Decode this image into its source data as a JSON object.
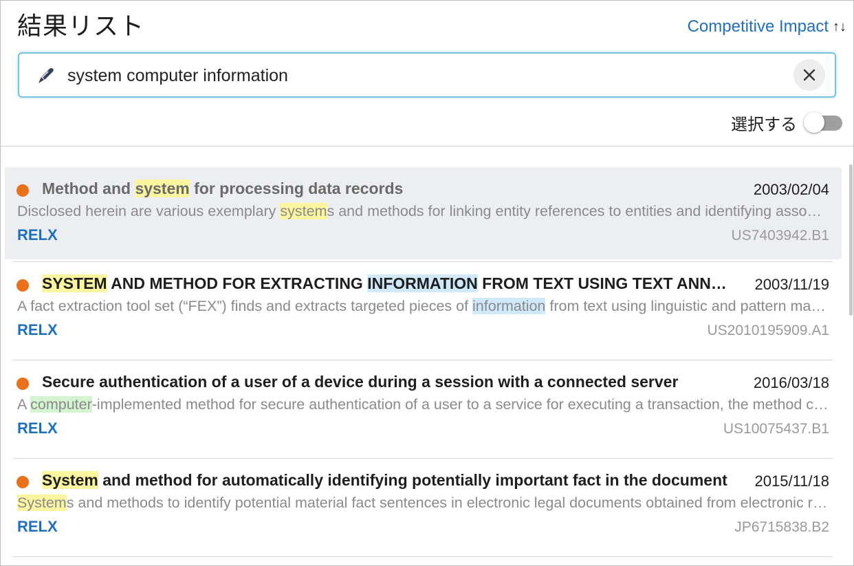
{
  "header": {
    "title": "結果リスト",
    "sort_label": "Competitive Impact",
    "sort_icon": "↑↓"
  },
  "search": {
    "value": "system computer information",
    "clear_icon": "×"
  },
  "select_toggle": {
    "label": "選択する",
    "on": false
  },
  "colors": {
    "accent": "#1f6fc0",
    "dot": "#e9711c",
    "highlight_system": "#fbf5a0",
    "highlight_information": "#cfe8fa",
    "highlight_computer": "#d4f3d0"
  },
  "results": [
    {
      "selected": true,
      "title": [
        {
          "t": "Method and "
        },
        {
          "t": "system",
          "hl": "y"
        },
        {
          "t": " for processing data records"
        }
      ],
      "date": "2003/02/04",
      "snippet": [
        {
          "t": "Disclosed herein are various exemplary "
        },
        {
          "t": "system",
          "hl": "y"
        },
        {
          "t": "s and methods for linking entity references to entities and identifying associations among entity references"
        }
      ],
      "source": "RELX",
      "pubno": "US7403942.B1"
    },
    {
      "selected": false,
      "title": [
        {
          "t": "SYSTEM",
          "hl": "y"
        },
        {
          "t": " AND METHOD FOR EXTRACTING "
        },
        {
          "t": "INFORMATION",
          "hl": "b"
        },
        {
          "t": " FROM TEXT USING TEXT ANNOTATION AND FACT EXTRACTION"
        }
      ],
      "date": "2003/11/19",
      "snippet": [
        {
          "t": "A fact extraction tool set (“FEX”) finds and extracts targeted pieces of "
        },
        {
          "t": "information",
          "hl": "b"
        },
        {
          "t": " from text using linguistic and pattern matching technologies"
        }
      ],
      "source": "RELX",
      "pubno": "US2010195909.A1"
    },
    {
      "selected": false,
      "title": [
        {
          "t": "Secure authentication of a user of a device during a session with a connected server"
        }
      ],
      "date": "2016/03/18",
      "snippet": [
        {
          "t": "A "
        },
        {
          "t": "computer",
          "hl": "g"
        },
        {
          "t": "-implemented method for secure authentication of a user to a service for executing a transaction, the method comprising"
        }
      ],
      "source": "RELX",
      "pubno": "US10075437.B1"
    },
    {
      "selected": false,
      "title": [
        {
          "t": "System",
          "hl": "y"
        },
        {
          "t": " and method for automatically identifying potentially important fact in the document"
        }
      ],
      "date": "2015/11/18",
      "snippet": [
        {
          "t": "System",
          "hl": "y"
        },
        {
          "t": "s and methods to identify potential material fact sentences in electronic legal documents obtained from electronic repositories"
        }
      ],
      "source": "RELX",
      "pubno": "JP6715838.B2"
    }
  ]
}
